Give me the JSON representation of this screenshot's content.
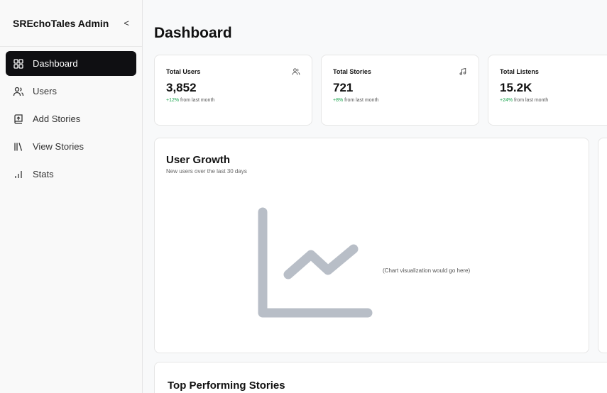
{
  "sidebar": {
    "brand": "SREchoTales Admin",
    "collapse_glyph": "<",
    "items": [
      {
        "label": "Dashboard",
        "icon": "layout-grid-icon",
        "active": true
      },
      {
        "label": "Users",
        "icon": "users-icon",
        "active": false
      },
      {
        "label": "Add Stories",
        "icon": "book-upload-icon",
        "active": false
      },
      {
        "label": "View Stories",
        "icon": "library-icon",
        "active": false
      },
      {
        "label": "Stats",
        "icon": "bar-chart-icon",
        "active": false
      }
    ]
  },
  "main": {
    "title": "Dashboard",
    "stats": [
      {
        "label": "Total Users",
        "value": "3,852",
        "delta": "+12%",
        "delta_text": " from last month",
        "icon": "users-icon"
      },
      {
        "label": "Total Stories",
        "value": "721",
        "delta": "+8%",
        "delta_text": " from last month",
        "icon": "music-icon"
      },
      {
        "label": "Total Listens",
        "value": "15.2K",
        "delta": "+24%",
        "delta_text": " from last month",
        "icon": "headphones-icon"
      }
    ],
    "growth": {
      "title": "User Growth",
      "subtitle": "New users over the last 30 days",
      "placeholder": "(Chart visualization would go here)"
    },
    "top_stories": {
      "title": "Top Performing Stories"
    }
  },
  "colors": {
    "active_nav_bg": "#0f0f12",
    "delta_up": "#16a34a",
    "chart_icon": "#b8bec7"
  }
}
